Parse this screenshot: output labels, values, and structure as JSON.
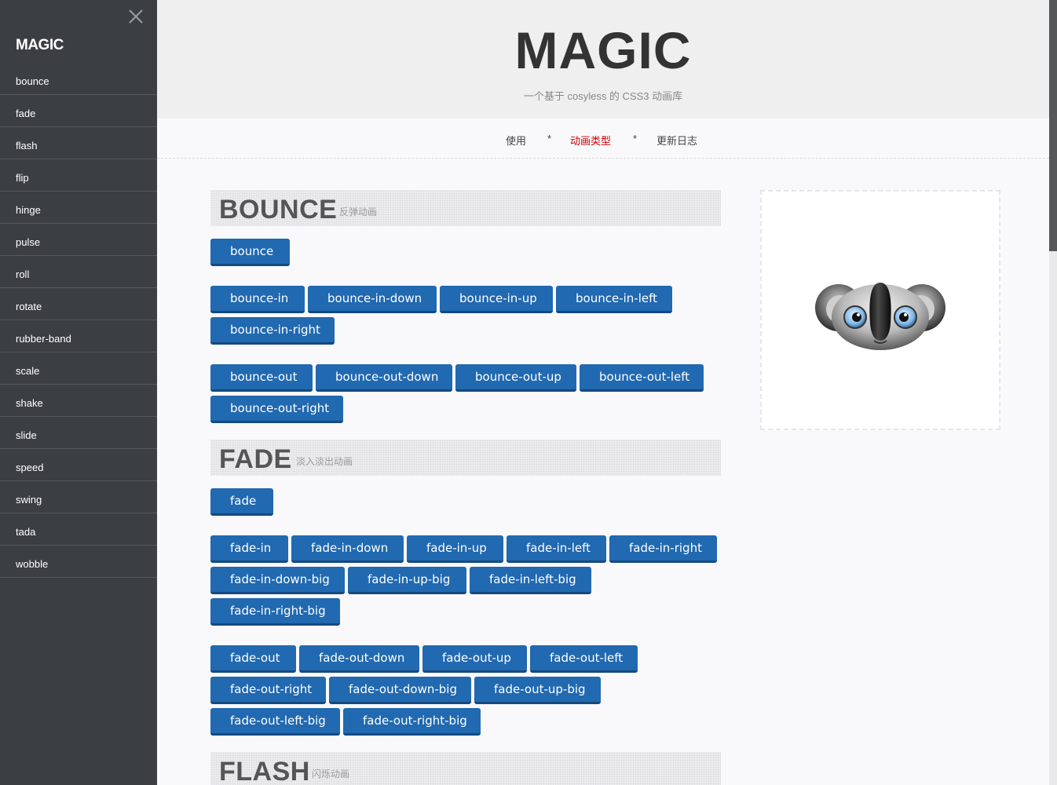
{
  "sidebar": {
    "brand": "MAGIC",
    "close_icon": "close-icon",
    "items": [
      "bounce",
      "fade",
      "flash",
      "flip",
      "hinge",
      "pulse",
      "roll",
      "rotate",
      "rubber-band",
      "scale",
      "shake",
      "slide",
      "speed",
      "swing",
      "tada",
      "wobble"
    ]
  },
  "header": {
    "title": "MAGIC",
    "subtitle": "一个基于 cosyless 的 CSS3 动画库"
  },
  "nav": {
    "usage": "使用",
    "sep": "*",
    "types": "动画类型",
    "changelog": "更新日志"
  },
  "sections": {
    "bounce": {
      "title": "BOUNCE",
      "subtitle": "反弹动画",
      "buttons": [
        "bounce",
        "bounce-in",
        "bounce-in-down",
        "bounce-in-up",
        "bounce-in-left",
        "bounce-in-right",
        "bounce-out",
        "bounce-out-down",
        "bounce-out-up",
        "bounce-out-left",
        "bounce-out-right"
      ]
    },
    "fade": {
      "title": "FADE",
      "subtitle": "淡入淡出动画",
      "buttons": [
        "fade",
        "fade-in",
        "fade-in-down",
        "fade-in-up",
        "fade-in-left",
        "fade-in-right",
        "fade-in-down-big",
        "fade-in-up-big",
        "fade-in-left-big",
        "fade-in-right-big",
        "fade-out",
        "fade-out-down",
        "fade-out-up",
        "fade-out-left",
        "fade-out-right",
        "fade-out-down-big",
        "fade-out-up-big",
        "fade-out-left-big",
        "fade-out-right-big"
      ]
    },
    "flash": {
      "title": "FLASH",
      "subtitle": "闪烁动画"
    }
  },
  "preview": {
    "image": "koala-icon"
  },
  "colors": {
    "sidebar": "#3c3f42",
    "button": "#2169b0",
    "active": "#d10000"
  }
}
